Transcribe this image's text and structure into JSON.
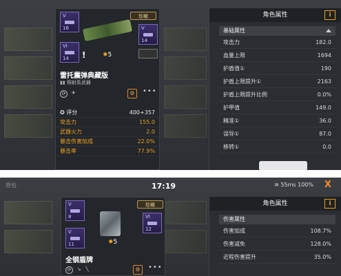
{
  "panel1": {
    "card": {
      "rarity": "珍稀",
      "mods": [
        {
          "rank": "V",
          "level": "16"
        },
        {
          "rank": "V",
          "level": "14"
        },
        {
          "rank": "VI",
          "level": "14"
        }
      ],
      "exclaim": "!",
      "stars": "5",
      "name": "雷托震弹典藏版",
      "subtitle": "照射系武器",
      "stats": [
        {
          "label": "评分",
          "value": "400+357"
        },
        {
          "label": "攻击力",
          "value": "155.0"
        },
        {
          "label": "武器火力",
          "value": "2.0"
        },
        {
          "label": "暴击伤害加成",
          "value": "22.0%"
        },
        {
          "label": "暴击率",
          "value": "77.9%"
        }
      ]
    },
    "attr": {
      "title": "角色属性",
      "group": "基础属性",
      "rows": [
        {
          "label": "攻击力",
          "value": "182.0"
        },
        {
          "label": "血量上限",
          "value": "1694"
        },
        {
          "label": "护盾值①",
          "value": "190"
        },
        {
          "label": "护盾上限提升①",
          "value": "2163"
        },
        {
          "label": "护盾上限提升比例",
          "value": "0.0%"
        },
        {
          "label": "护甲值",
          "value": "149.0"
        },
        {
          "label": "精准①",
          "value": "36.0"
        },
        {
          "label": "误导①",
          "value": "87.0"
        },
        {
          "label": "移转①",
          "value": "0.0"
        }
      ]
    }
  },
  "panel2": {
    "status": {
      "bag": "背包",
      "time": "17:19",
      "net": "55ms 100%",
      "close": "X"
    },
    "card": {
      "rarity": "珍稀",
      "mods": [
        {
          "rank": "V",
          "level": "8"
        },
        {
          "rank": "VI",
          "level": "12"
        },
        {
          "rank": "V",
          "level": "11"
        }
      ],
      "stars": "5",
      "name": "全钢盾牌"
    },
    "attr": {
      "title": "角色属性",
      "group": "伤害属性",
      "rows": [
        {
          "label": "伤害加成",
          "value": "108.7%"
        },
        {
          "label": "伤害减免",
          "value": "128.0%"
        },
        {
          "label": "近程伤害提升",
          "value": "35.0%"
        }
      ]
    }
  },
  "colors": {
    "accent": "#e8a020",
    "mod_purple": "#7d6bb8",
    "close": "#f08a2a"
  }
}
